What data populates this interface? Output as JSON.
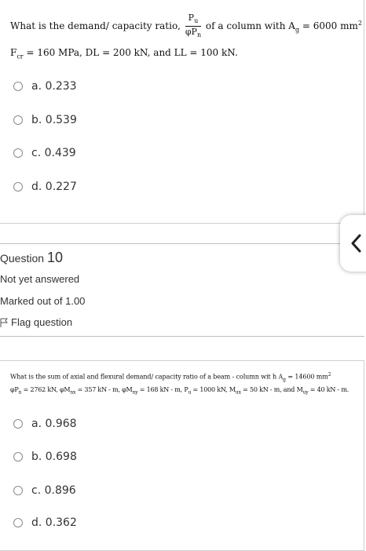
{
  "q1": {
    "prompt_start": "What is the demand/ capacity ratio,",
    "frac_num": "P",
    "frac_num_sub": "u",
    "frac_den": "φP",
    "frac_den_sub": "n",
    "prompt_mid": "of a column with A",
    "ag_sub": "g",
    "ag_value": "= 6000 mm",
    "ag_sup": "2",
    "line2": "F",
    "fcr_sub": "cr",
    "line2_rest": "= 160 MPa, DL = 200 kN, and LL = 100 kN.",
    "options": [
      {
        "label": "a. 0.233"
      },
      {
        "label": "b. 0.539"
      },
      {
        "label": "c. 0.439"
      },
      {
        "label": "d. 0.227"
      }
    ]
  },
  "info": {
    "question_word": "Question",
    "question_number": "10",
    "status": "Not yet answered",
    "marks": "Marked out of 1.00",
    "flag": "Flag question"
  },
  "q2": {
    "line1": "What is the sum of axial and flexural demand/ capacity ratio of a beam - column wit h A",
    "line1_sub": "g",
    "line1_end": "= 14600 mm",
    "line1_sup": "2",
    "line2": "φP",
    "l2_s1": "n",
    "l2_t1": "= 2762 kN, φM",
    "l2_s2": "nx",
    "l2_t2": "= 357 kN - m, φM",
    "l2_s3": "ny",
    "l2_t3": "= 168 kN - m, P",
    "l2_s4": "u",
    "l2_t4": "= 1000 kN, M",
    "l2_s5": "ux",
    "l2_t5": "= 50 kN - m, and M",
    "l2_s6": "uy",
    "l2_t6": "= 40 kN - m.",
    "options": [
      {
        "label": "a. 0.968"
      },
      {
        "label": "b. 0.698"
      },
      {
        "label": "c. 0.896"
      },
      {
        "label": "d. 0.362"
      }
    ]
  }
}
